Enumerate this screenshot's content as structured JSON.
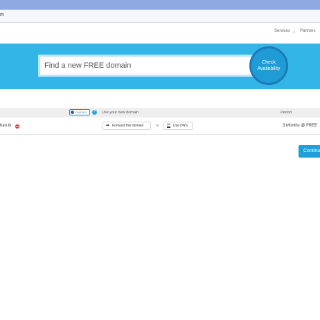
{
  "browser": {
    "address_fragment": "m"
  },
  "nav": {
    "services": "Services",
    "partners": "Partners"
  },
  "hero": {
    "search_placeholder": "Find a new FREE domain",
    "check_button": "Check Availability"
  },
  "table": {
    "header_use_new": "Use your new domain",
    "header_period": "Period",
    "dns_badge": "DNSSEC",
    "help_icon": "?",
    "rows": [
      {
        "domain": "han.tk",
        "forward_label": "Forward this domain",
        "or_text": "or",
        "dns_label": "Use DNS",
        "period": "3 Months @ FREE"
      }
    ]
  },
  "continue_label": "Continue",
  "colors": {
    "hero_bg": "#33b5e7",
    "check_button": "#1f9bd6",
    "continue_button": "#1ea0db",
    "remove_icon": "#d9383a"
  },
  "icons": [
    "chevron-down-icon",
    "help-icon",
    "remove-icon",
    "forward-icon",
    "list-icon"
  ]
}
